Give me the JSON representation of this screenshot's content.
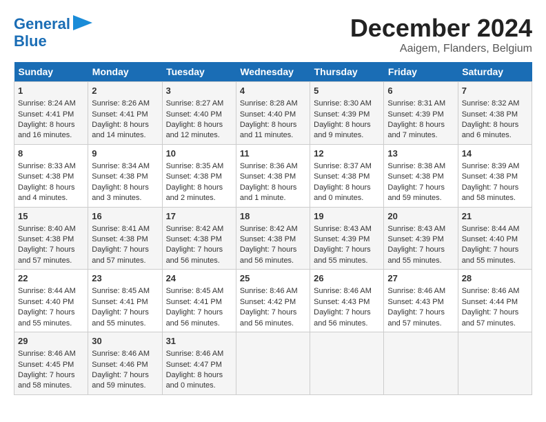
{
  "logo": {
    "line1": "General",
    "line2": "Blue"
  },
  "title": "December 2024",
  "subtitle": "Aaigem, Flanders, Belgium",
  "headers": [
    "Sunday",
    "Monday",
    "Tuesday",
    "Wednesday",
    "Thursday",
    "Friday",
    "Saturday"
  ],
  "rows": [
    [
      {
        "day": "1",
        "info": "Sunrise: 8:24 AM\nSunset: 4:41 PM\nDaylight: 8 hours and 16 minutes."
      },
      {
        "day": "2",
        "info": "Sunrise: 8:26 AM\nSunset: 4:41 PM\nDaylight: 8 hours and 14 minutes."
      },
      {
        "day": "3",
        "info": "Sunrise: 8:27 AM\nSunset: 4:40 PM\nDaylight: 8 hours and 12 minutes."
      },
      {
        "day": "4",
        "info": "Sunrise: 8:28 AM\nSunset: 4:40 PM\nDaylight: 8 hours and 11 minutes."
      },
      {
        "day": "5",
        "info": "Sunrise: 8:30 AM\nSunset: 4:39 PM\nDaylight: 8 hours and 9 minutes."
      },
      {
        "day": "6",
        "info": "Sunrise: 8:31 AM\nSunset: 4:39 PM\nDaylight: 8 hours and 7 minutes."
      },
      {
        "day": "7",
        "info": "Sunrise: 8:32 AM\nSunset: 4:38 PM\nDaylight: 8 hours and 6 minutes."
      }
    ],
    [
      {
        "day": "8",
        "info": "Sunrise: 8:33 AM\nSunset: 4:38 PM\nDaylight: 8 hours and 4 minutes."
      },
      {
        "day": "9",
        "info": "Sunrise: 8:34 AM\nSunset: 4:38 PM\nDaylight: 8 hours and 3 minutes."
      },
      {
        "day": "10",
        "info": "Sunrise: 8:35 AM\nSunset: 4:38 PM\nDaylight: 8 hours and 2 minutes."
      },
      {
        "day": "11",
        "info": "Sunrise: 8:36 AM\nSunset: 4:38 PM\nDaylight: 8 hours and 1 minute."
      },
      {
        "day": "12",
        "info": "Sunrise: 8:37 AM\nSunset: 4:38 PM\nDaylight: 8 hours and 0 minutes."
      },
      {
        "day": "13",
        "info": "Sunrise: 8:38 AM\nSunset: 4:38 PM\nDaylight: 7 hours and 59 minutes."
      },
      {
        "day": "14",
        "info": "Sunrise: 8:39 AM\nSunset: 4:38 PM\nDaylight: 7 hours and 58 minutes."
      }
    ],
    [
      {
        "day": "15",
        "info": "Sunrise: 8:40 AM\nSunset: 4:38 PM\nDaylight: 7 hours and 57 minutes."
      },
      {
        "day": "16",
        "info": "Sunrise: 8:41 AM\nSunset: 4:38 PM\nDaylight: 7 hours and 57 minutes."
      },
      {
        "day": "17",
        "info": "Sunrise: 8:42 AM\nSunset: 4:38 PM\nDaylight: 7 hours and 56 minutes."
      },
      {
        "day": "18",
        "info": "Sunrise: 8:42 AM\nSunset: 4:38 PM\nDaylight: 7 hours and 56 minutes."
      },
      {
        "day": "19",
        "info": "Sunrise: 8:43 AM\nSunset: 4:39 PM\nDaylight: 7 hours and 55 minutes."
      },
      {
        "day": "20",
        "info": "Sunrise: 8:43 AM\nSunset: 4:39 PM\nDaylight: 7 hours and 55 minutes."
      },
      {
        "day": "21",
        "info": "Sunrise: 8:44 AM\nSunset: 4:40 PM\nDaylight: 7 hours and 55 minutes."
      }
    ],
    [
      {
        "day": "22",
        "info": "Sunrise: 8:44 AM\nSunset: 4:40 PM\nDaylight: 7 hours and 55 minutes."
      },
      {
        "day": "23",
        "info": "Sunrise: 8:45 AM\nSunset: 4:41 PM\nDaylight: 7 hours and 55 minutes."
      },
      {
        "day": "24",
        "info": "Sunrise: 8:45 AM\nSunset: 4:41 PM\nDaylight: 7 hours and 56 minutes."
      },
      {
        "day": "25",
        "info": "Sunrise: 8:46 AM\nSunset: 4:42 PM\nDaylight: 7 hours and 56 minutes."
      },
      {
        "day": "26",
        "info": "Sunrise: 8:46 AM\nSunset: 4:43 PM\nDaylight: 7 hours and 56 minutes."
      },
      {
        "day": "27",
        "info": "Sunrise: 8:46 AM\nSunset: 4:43 PM\nDaylight: 7 hours and 57 minutes."
      },
      {
        "day": "28",
        "info": "Sunrise: 8:46 AM\nSunset: 4:44 PM\nDaylight: 7 hours and 57 minutes."
      }
    ],
    [
      {
        "day": "29",
        "info": "Sunrise: 8:46 AM\nSunset: 4:45 PM\nDaylight: 7 hours and 58 minutes."
      },
      {
        "day": "30",
        "info": "Sunrise: 8:46 AM\nSunset: 4:46 PM\nDaylight: 7 hours and 59 minutes."
      },
      {
        "day": "31",
        "info": "Sunrise: 8:46 AM\nSunset: 4:47 PM\nDaylight: 8 hours and 0 minutes."
      },
      {
        "day": "",
        "info": ""
      },
      {
        "day": "",
        "info": ""
      },
      {
        "day": "",
        "info": ""
      },
      {
        "day": "",
        "info": ""
      }
    ]
  ]
}
